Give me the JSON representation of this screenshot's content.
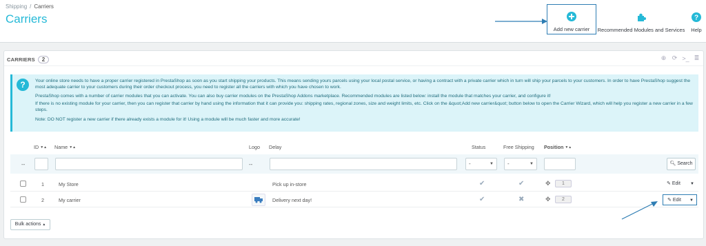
{
  "breadcrumb": {
    "parent": "Shipping",
    "separator": "/",
    "current": "Carriers"
  },
  "page_title": "Carriers",
  "toolbar": {
    "add_label": "Add new carrier",
    "modules_label": "Recommended Modules and Services",
    "help_label": "Help"
  },
  "panel": {
    "title": "CARRIERS",
    "count": "2"
  },
  "alert": {
    "p1": "Your online store needs to have a proper carrier registered in PrestaShop as soon as you start shipping your products. This means sending yours parcels using your local postal service, or having a contract with a private carrier which in turn will ship your parcels to your customers. In order to have PrestaShop suggest the most adequate carrier to your customers during their order checkout process, you need to register all the carriers with which you have chosen to work.",
    "p2": "PrestaShop comes with a number of carrier modules that you can activate. You can also buy carrier modules on the PrestaShop Addons marketplace. Recommended modules are listed below: install the module that matches your carrier, and configure it!",
    "p3": "If there is no existing module for your carrier, then you can register that carrier by hand using the information that it can provide you: shipping rates, regional zones, size and weight limits, etc. Click on the &quot;Add new carrier&quot; button below to open the Carrier Wizard, which will help you register a new carrier in a few steps.",
    "p4": "Note: DO NOT register a new carrier if there already exists a module for it! Using a module will be much faster and more accurate!"
  },
  "table": {
    "headers": {
      "id": "ID",
      "name": "Name",
      "logo": "Logo",
      "delay": "Delay",
      "status": "Status",
      "free_shipping": "Free Shipping",
      "position": "Position"
    },
    "filter": {
      "dash": "--",
      "select_placeholder": "-",
      "search_label": "Search"
    },
    "rows": [
      {
        "id": "1",
        "name": "My Store",
        "delay": "Pick up in-store",
        "status": "✔",
        "free_shipping": "✔",
        "position": "1",
        "edit": "Edit"
      },
      {
        "id": "2",
        "name": "My carrier",
        "delay": "Delivery next day!",
        "status": "✔",
        "free_shipping": "✖",
        "position": "2",
        "edit": "Edit"
      }
    ]
  },
  "bulk_actions_label": "Bulk actions",
  "colors": {
    "accent": "#25b9d7",
    "highlight": "#2e7db3"
  }
}
